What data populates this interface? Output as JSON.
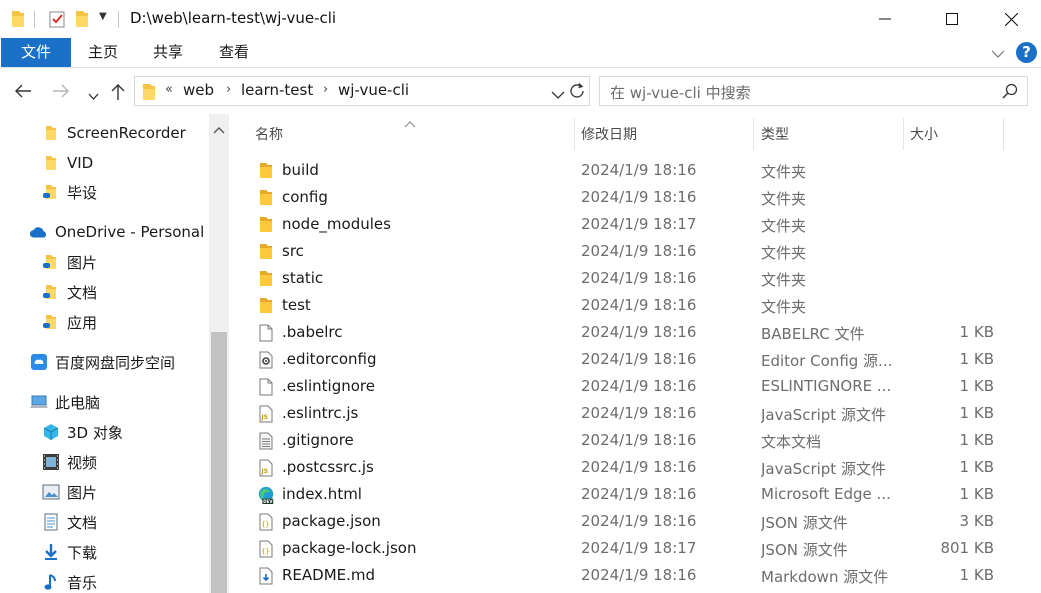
{
  "window": {
    "title": "D:\\web\\learn-test\\wj-vue-cli"
  },
  "ribbon": {
    "tabs": [
      "文件",
      "主页",
      "共享",
      "查看"
    ],
    "help_label": "?"
  },
  "address": {
    "overflow_chevron": "«",
    "crumbs": [
      "web",
      "learn-test",
      "wj-vue-cli"
    ],
    "separator": "›"
  },
  "search": {
    "placeholder": "在 wj-vue-cli 中搜索"
  },
  "sidebar": {
    "items": [
      {
        "label": "ScreenRecorder",
        "icon": "folder-icon"
      },
      {
        "label": "VID",
        "icon": "folder-icon"
      },
      {
        "label": "毕设",
        "icon": "folder-cloud-icon"
      },
      {
        "label": "OneDrive - Personal",
        "icon": "onedrive-icon"
      },
      {
        "label": "图片",
        "icon": "folder-cloud-icon"
      },
      {
        "label": "文档",
        "icon": "folder-cloud-icon"
      },
      {
        "label": "应用",
        "icon": "folder-cloud-icon"
      },
      {
        "label": "百度网盘同步空间",
        "icon": "baidu-netdisk-icon"
      },
      {
        "label": "此电脑",
        "icon": "this-pc-icon"
      },
      {
        "label": "3D 对象",
        "icon": "3d-objects-icon"
      },
      {
        "label": "视频",
        "icon": "videos-icon"
      },
      {
        "label": "图片",
        "icon": "pictures-icon"
      },
      {
        "label": "文档",
        "icon": "documents-icon"
      },
      {
        "label": "下载",
        "icon": "downloads-icon"
      },
      {
        "label": "音乐",
        "icon": "music-icon"
      }
    ]
  },
  "columns": {
    "name": "名称",
    "date": "修改日期",
    "type": "类型",
    "size": "大小"
  },
  "files": [
    {
      "name": "build",
      "date": "2024/1/9 18:16",
      "type": "文件夹",
      "size": "",
      "icon": "folder-icon"
    },
    {
      "name": "config",
      "date": "2024/1/9 18:16",
      "type": "文件夹",
      "size": "",
      "icon": "folder-icon"
    },
    {
      "name": "node_modules",
      "date": "2024/1/9 18:17",
      "type": "文件夹",
      "size": "",
      "icon": "folder-icon"
    },
    {
      "name": "src",
      "date": "2024/1/9 18:16",
      "type": "文件夹",
      "size": "",
      "icon": "folder-icon"
    },
    {
      "name": "static",
      "date": "2024/1/9 18:16",
      "type": "文件夹",
      "size": "",
      "icon": "folder-icon"
    },
    {
      "name": "test",
      "date": "2024/1/9 18:16",
      "type": "文件夹",
      "size": "",
      "icon": "folder-icon"
    },
    {
      "name": ".babelrc",
      "date": "2024/1/9 18:16",
      "type": "BABELRC 文件",
      "size": "1 KB",
      "icon": "blank-file-icon"
    },
    {
      "name": ".editorconfig",
      "date": "2024/1/9 18:16",
      "type": "Editor Config 源...",
      "size": "1 KB",
      "icon": "config-file-icon"
    },
    {
      "name": ".eslintignore",
      "date": "2024/1/9 18:16",
      "type": "ESLINTIGNORE ...",
      "size": "1 KB",
      "icon": "blank-file-icon"
    },
    {
      "name": ".eslintrc.js",
      "date": "2024/1/9 18:16",
      "type": "JavaScript 源文件",
      "size": "1 KB",
      "icon": "js-file-icon"
    },
    {
      "name": ".gitignore",
      "date": "2024/1/9 18:16",
      "type": "文本文档",
      "size": "1 KB",
      "icon": "text-file-icon"
    },
    {
      "name": ".postcssrc.js",
      "date": "2024/1/9 18:16",
      "type": "JavaScript 源文件",
      "size": "1 KB",
      "icon": "js-file-icon"
    },
    {
      "name": "index.html",
      "date": "2024/1/9 18:16",
      "type": "Microsoft Edge ...",
      "size": "1 KB",
      "icon": "edge-dev-icon"
    },
    {
      "name": "package.json",
      "date": "2024/1/9 18:16",
      "type": "JSON 源文件",
      "size": "3 KB",
      "icon": "json-file-icon"
    },
    {
      "name": "package-lock.json",
      "date": "2024/1/9 18:17",
      "type": "JSON 源文件",
      "size": "801 KB",
      "icon": "json-file-icon"
    },
    {
      "name": "README.md",
      "date": "2024/1/9 18:16",
      "type": "Markdown 源文件",
      "size": "1 KB",
      "icon": "markdown-file-icon"
    }
  ]
}
